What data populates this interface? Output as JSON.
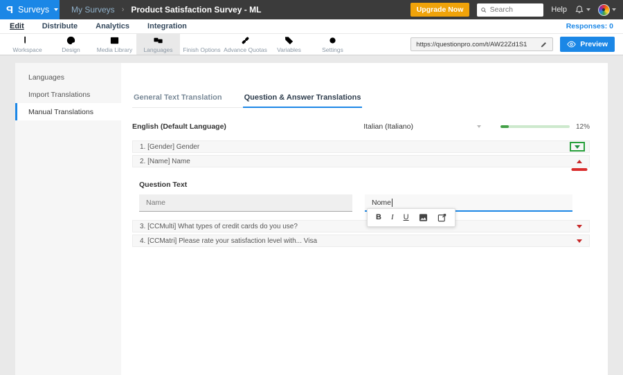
{
  "topbar": {
    "logo_text": "P",
    "product_menu_label": "Surveys",
    "breadcrumb": {
      "parent": "My Surveys",
      "separator": "›",
      "current": "Product Satisfaction Survey - ML"
    },
    "upgrade_label": "Upgrade Now",
    "search_placeholder": "Search",
    "help_label": "Help"
  },
  "menubar": {
    "items": [
      {
        "label": "Edit",
        "active": true
      },
      {
        "label": "Distribute",
        "active": false
      },
      {
        "label": "Analytics",
        "active": false
      },
      {
        "label": "Integration",
        "active": false
      }
    ],
    "responses_label": "Responses: 0"
  },
  "icon_toolbar": {
    "items": [
      {
        "label": "Workspace",
        "icon": "workspace-icon",
        "active": false
      },
      {
        "label": "Design",
        "icon": "design-icon",
        "active": false
      },
      {
        "label": "Media Library",
        "icon": "media-library-icon",
        "active": false
      },
      {
        "label": "Languages",
        "icon": "languages-icon",
        "active": true
      },
      {
        "label": "Finish Options",
        "icon": "finish-options-icon",
        "active": false
      },
      {
        "label": "Advance Quotas",
        "icon": "advance-quotas-icon",
        "active": false
      },
      {
        "label": "Variables",
        "icon": "variables-icon",
        "active": false
      },
      {
        "label": "Settings",
        "icon": "settings-icon",
        "active": false
      }
    ],
    "survey_url": "https://questionpro.com/t/AW22Zd1S1",
    "preview_label": "Preview"
  },
  "sidebar": {
    "items": [
      {
        "label": "Languages",
        "active": false
      },
      {
        "label": "Import Translations",
        "active": false
      },
      {
        "label": "Manual Translations",
        "active": true
      }
    ]
  },
  "main": {
    "tabs": [
      {
        "label": "General Text Translation",
        "active": false
      },
      {
        "label": "Question & Answer Translations",
        "active": true
      }
    ],
    "source_language": "English (Default Language)",
    "target_language": "Italian (Italiano)",
    "progress_percent": "12%",
    "questions": [
      {
        "title": "1. [Gender] Gender",
        "state": "collapsed"
      },
      {
        "title": "2. [Name] Name",
        "state": "expanded"
      },
      {
        "title": "3. [CCMulti] What types of credit cards do you use?",
        "state": "collapsed"
      },
      {
        "title": "4. [CCMatri] Please rate your satisfaction level with... Visa",
        "state": "collapsed"
      }
    ],
    "editor": {
      "section_label": "Question Text",
      "source_text": "Name",
      "translation_text": "Nome",
      "format_toolbar": {
        "bold": "B",
        "italic": "I",
        "underline": "U"
      }
    }
  },
  "colors": {
    "accent_blue": "#1b87e6",
    "topbar_dark": "#3b3b3b",
    "upgrade_orange": "#f0a30a",
    "progress_green": "#43a047",
    "progress_track": "#cde9cd",
    "caret_red": "#c62828",
    "highlight_green": "#28a03c"
  }
}
